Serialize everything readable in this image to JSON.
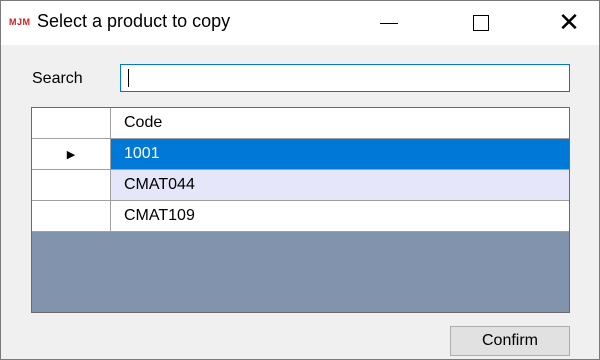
{
  "window": {
    "logo_text": "MJM",
    "title": "Select a product to copy",
    "minimize_icon": "minimize-icon",
    "maximize_icon": "maximize-icon",
    "close_icon": "close-icon",
    "close_glyph": "✕"
  },
  "search": {
    "label": "Search",
    "value": "",
    "placeholder": ""
  },
  "grid": {
    "columns": [
      "Code"
    ],
    "rows": [
      {
        "code": "1001",
        "selected": true,
        "indicator": "▶"
      },
      {
        "code": "CMAT044",
        "selected": false
      },
      {
        "code": "CMAT109",
        "selected": false
      }
    ],
    "background_color": "#8293ae",
    "selection_color": "#0078d7",
    "alt_row_color": "#e6e6fa"
  },
  "actions": {
    "confirm_label": "Confirm"
  }
}
